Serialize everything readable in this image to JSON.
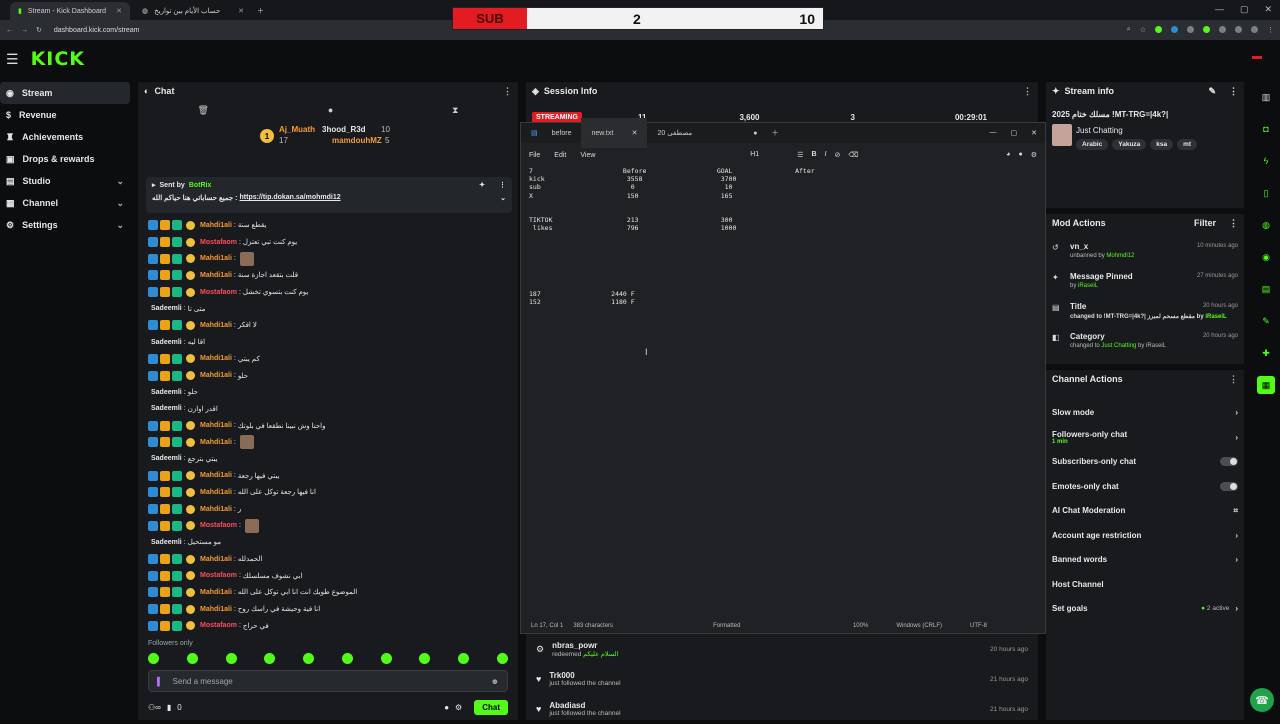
{
  "browser": {
    "tabs": [
      {
        "label": "Stream - Kick Dashboard"
      },
      {
        "label": "حساب الأيام بين تواريخ"
      }
    ],
    "url": "dashboard.kick.com/stream"
  },
  "scoreboard": {
    "label": "SUB",
    "value_a": "2",
    "value_b": "10"
  },
  "header": {
    "logo": "KICK"
  },
  "sidebar": {
    "items": [
      {
        "label": "Stream",
        "icon": "broadcast-icon"
      },
      {
        "label": "Revenue",
        "icon": "dollar-icon"
      },
      {
        "label": "Achievements",
        "icon": "trophy-icon"
      },
      {
        "label": "Drops & rewards",
        "icon": "gift-icon"
      },
      {
        "label": "Studio",
        "icon": "studio-icon"
      },
      {
        "label": "Channel",
        "icon": "channel-icon"
      },
      {
        "label": "Settings",
        "icon": "gear-icon"
      }
    ]
  },
  "chat": {
    "title": "Chat",
    "gifters": [
      {
        "name": "Aj_Muath",
        "count": "10"
      },
      {
        "name": "3hood_R3d",
        "count": "17"
      },
      {
        "name": "mamdouhMZ",
        "count": "5"
      }
    ],
    "pinned": {
      "sent_by_label": "Sent by",
      "sender": "BotRix",
      "text": "جميع حساباتي هنا حياكم الله : ",
      "link": "https://tip.dokan.sa/mohmdi12"
    },
    "messages": [
      {
        "name": "Mahdi1ali",
        "color": "orange",
        "text": "يقطع سنة",
        "badges": true
      },
      {
        "name": "Mostafaom",
        "color": "pink",
        "text": "يوم كنت تبي تعتزل",
        "badges": true
      },
      {
        "name": "Mahdi1ali",
        "color": "orange",
        "text": "",
        "badges": true,
        "img": true
      },
      {
        "name": "Mahdi1ali",
        "color": "orange",
        "text": "قلت بتقعد اجازة سنة",
        "badges": true
      },
      {
        "name": "Mostafaom",
        "color": "pink",
        "text": "يوم كنت بتسوي تخشل",
        "badges": true
      },
      {
        "name": "Sadeemli",
        "color": "white",
        "text": "متى تا",
        "badges": false
      },
      {
        "name": "Mahdi1ali",
        "color": "orange",
        "text": "لا افكر",
        "badges": true
      },
      {
        "name": "Sadeemli",
        "color": "white",
        "text": "اقا ليه",
        "badges": false
      },
      {
        "name": "Mahdi1ali",
        "color": "orange",
        "text": "كم يبتي",
        "badges": true
      },
      {
        "name": "Mahdi1ali",
        "color": "orange",
        "text": "حلو",
        "badges": true
      },
      {
        "name": "Sadeemli",
        "color": "white",
        "text": "حلو",
        "badges": false
      },
      {
        "name": "Sadeemli",
        "color": "white",
        "text": "اقدر اوازن",
        "badges": false
      },
      {
        "name": "Mahdi1ali",
        "color": "orange",
        "text": "واحنا وش نبينا نطقعا في بلوتك",
        "badges": true
      },
      {
        "name": "Mahdi1ali",
        "color": "orange",
        "text": "",
        "badges": true,
        "img": true
      },
      {
        "name": "Sadeemli",
        "color": "white",
        "text": "يبتي بترجع",
        "badges": false
      },
      {
        "name": "Mahdi1ali",
        "color": "orange",
        "text": "يبتي فيها رجعة",
        "badges": true
      },
      {
        "name": "Mahdi1ali",
        "color": "orange",
        "text": "انا فيها رجعة توكل على الله",
        "badges": true
      },
      {
        "name": "Mahdi1ali",
        "color": "orange",
        "text": "ر",
        "badges": true
      },
      {
        "name": "Mostafaom",
        "color": "pink",
        "text": "",
        "badges": true,
        "img": true
      },
      {
        "name": "Sadeemli",
        "color": "white",
        "text": "مو مستحيل",
        "badges": false
      },
      {
        "name": "Mahdi1ali",
        "color": "orange",
        "text": "الحمدلله",
        "badges": true
      },
      {
        "name": "Mostafaom",
        "color": "pink",
        "text": "ابي نشوف مسلسلك",
        "badges": true
      },
      {
        "name": "Mahdi1ali",
        "color": "orange",
        "text": "الموضوع طويك انت انا ابي توكل على الله",
        "badges": true
      },
      {
        "name": "Mahdi1ali",
        "color": "orange",
        "text": "انا فية وحيشة في راسك روح",
        "badges": true
      },
      {
        "name": "Mostafaom",
        "color": "pink",
        "text": "في حراج",
        "badges": true
      }
    ],
    "followers_only": "Followers only",
    "input_placeholder": "Send a message",
    "count": "0",
    "send_label": "Chat"
  },
  "session": {
    "title": "Session Info",
    "status": "STREAMING",
    "viewers": "11",
    "followers": "3,600",
    "subs": "3",
    "uptime": "00:29:01"
  },
  "notepad": {
    "tabs": [
      {
        "label": "before"
      },
      {
        "label": "new.txt"
      },
      {
        "label": "20 مصطفى"
      }
    ],
    "menu": [
      "File",
      "Edit",
      "View"
    ],
    "heading": "H1",
    "content": "7                       Before                  GOAL                After\nkick                     3558                    3700\nsub                       0                       10\nX                        150                     165\n\n\nTIKTOK                   213                     300\n likes                   796                     1000\n\n\n\n\n\n\n\n187                  2440 F\n152                  1180 F",
    "status": {
      "position": "Ln 17, Col 1",
      "chars": "383 characters",
      "format": "Formatted",
      "zoom": "100%",
      "eol": "Windows (CRLF)",
      "enc": "UTF-8"
    }
  },
  "activity": [
    {
      "name": "nbras_powr",
      "sub": "redeemed",
      "extra": "السلام عليكم",
      "time": "20 hours ago"
    },
    {
      "name": "Trk000",
      "sub": "just followed the channel",
      "extra": "",
      "time": "21 hours ago"
    },
    {
      "name": "Abadiasd",
      "sub": "just followed the channel",
      "extra": "",
      "time": "21 hours ago"
    }
  ],
  "stream_info": {
    "title_label": "Stream info",
    "title": "مسلك ختام 2025 !MT-TRG=|4k?|",
    "category": "Just Chatting",
    "tags": [
      "Arabic",
      "Yakuza",
      "ksa",
      "mt"
    ]
  },
  "mod_actions": {
    "title": "Mod Actions",
    "filter": "Filter",
    "items": [
      {
        "title": "vn_x",
        "desc_pre": "unbanned by ",
        "user": "Mohmdl12",
        "desc_post": "",
        "time": "10 minutes ago",
        "icon": "undo-icon"
      },
      {
        "title": "Message Pinned",
        "desc_pre": "by ",
        "user": "iRaseiL",
        "desc_post": "",
        "time": "27 minutes ago",
        "icon": "pin-icon"
      },
      {
        "title": "Title",
        "desc_pre": "changed to !MT-TRG=|4k?| مقطع مسحم لمبرز",
        "user": "iRaseiL",
        "desc_post": " by ",
        "time": "20 hours ago",
        "icon": "text-icon"
      },
      {
        "title": "Category",
        "desc_pre": "changed to ",
        "user": "Just Chatting",
        "desc_post": " by iRaseiL",
        "time": "20 hours ago",
        "icon": "category-icon"
      }
    ]
  },
  "channel_actions": {
    "title": "Channel Actions",
    "items": [
      {
        "label": "Slow mode",
        "kind": "chev"
      },
      {
        "label": "Followers-only chat",
        "sub": "1 min",
        "kind": "chev"
      },
      {
        "label": "Subscribers-only chat",
        "kind": "toggle"
      },
      {
        "label": "Emotes-only chat",
        "kind": "toggle"
      },
      {
        "label": "AI Chat Moderation",
        "kind": "chart"
      },
      {
        "label": "Account age restriction",
        "kind": "chev"
      },
      {
        "label": "Banned words",
        "kind": "chev"
      },
      {
        "label": "Host Channel",
        "kind": "none"
      },
      {
        "label": "Set goals",
        "sub_right": "2 active",
        "kind": "chev"
      }
    ]
  },
  "colors": {
    "accent": "#53fc18",
    "live": "#e31b23",
    "orange": "#f39c34",
    "pink": "#ff4d5e"
  }
}
